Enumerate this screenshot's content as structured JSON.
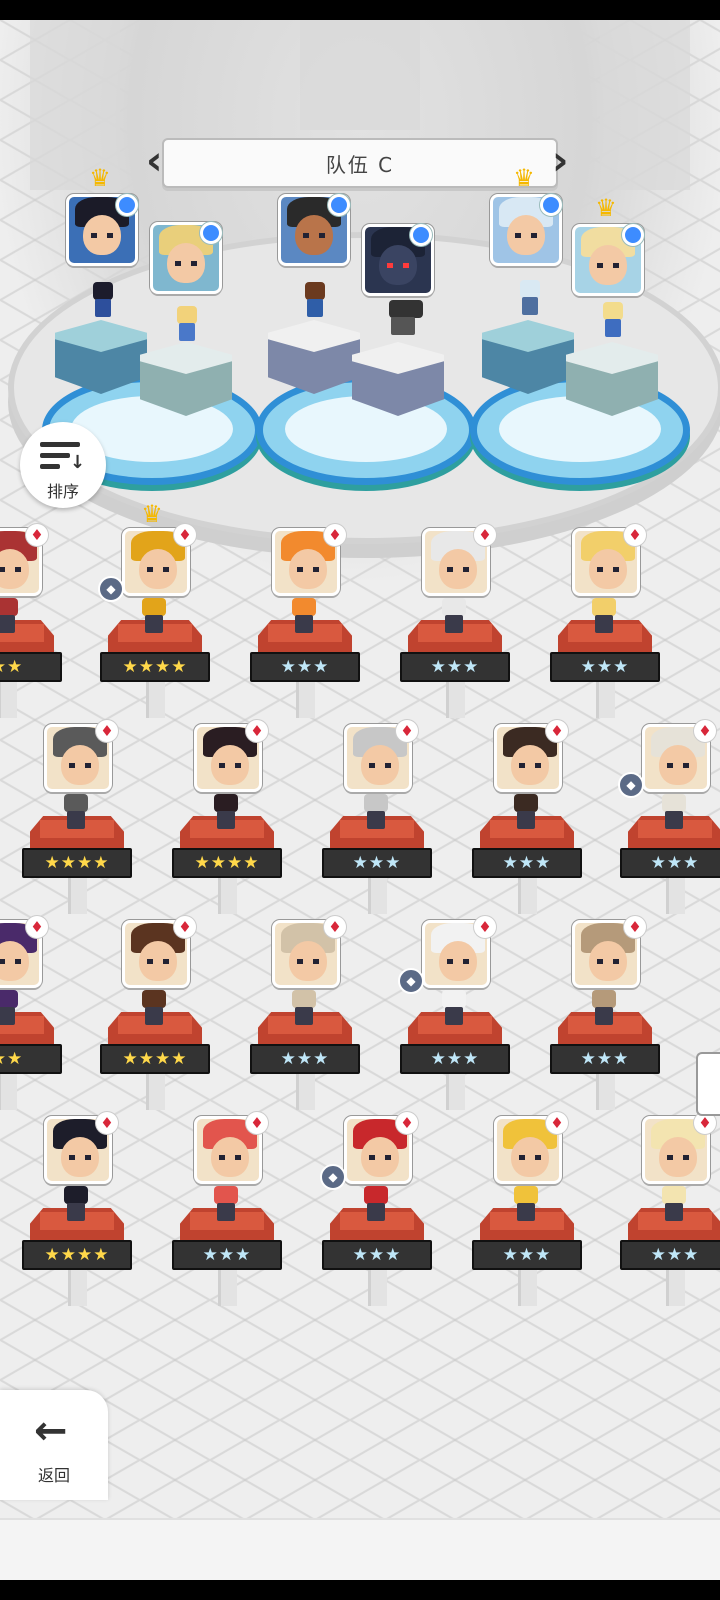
{
  "team": {
    "title": "队伍 C",
    "prev_icon": "chevron-left-icon",
    "next_icon": "chevron-right-icon"
  },
  "colors": {
    "accent": "#2f8fd6",
    "pedestal_red": "#c0432f",
    "star_gold": "#ffd84a",
    "star_silver": "#bfe6f7",
    "suit_red": "#d8273a"
  },
  "sort_button": {
    "label": "排序",
    "icon": "sort-descending-icon"
  },
  "back_button": {
    "label": "返回",
    "icon": "arrow-left-icon"
  },
  "roster_rows": [
    [
      {
        "stars": "★★",
        "gold": true,
        "suit": "♦",
        "hair": "#a33",
        "crown": false,
        "gem": false
      },
      {
        "stars": "★★★★",
        "gold": true,
        "suit": "♦",
        "hair": "#e2a41a",
        "crown": true,
        "gem": true
      },
      {
        "stars": "★★★",
        "gold": false,
        "suit": "♦",
        "hair": "#f28a2e",
        "crown": false,
        "gem": false
      },
      {
        "stars": "★★★",
        "gold": false,
        "suit": "♦",
        "hair": "#e8e8e8",
        "crown": false,
        "gem": false
      },
      {
        "stars": "★★★",
        "gold": false,
        "suit": "♦",
        "hair": "#f2cf6a",
        "crown": false,
        "gem": false
      }
    ],
    [
      {
        "stars": "★★★★",
        "gold": true,
        "suit": "♦",
        "hair": "#5a5a5a",
        "crown": false,
        "gem": false
      },
      {
        "stars": "★★★★",
        "gold": true,
        "suit": "♦",
        "hair": "#2a1d22",
        "crown": false,
        "gem": false
      },
      {
        "stars": "★★★",
        "gold": false,
        "suit": "♦",
        "hair": "#c7c7c7",
        "crown": false,
        "gem": false
      },
      {
        "stars": "★★★",
        "gold": false,
        "suit": "♦",
        "hair": "#3b2a22",
        "crown": false,
        "gem": false
      },
      {
        "stars": "★★★",
        "gold": false,
        "suit": "♦",
        "hair": "#e6e2d8",
        "crown": false,
        "gem": true
      }
    ],
    [
      {
        "stars": "★★",
        "gold": true,
        "suit": "♦",
        "hair": "#4a2a6a",
        "crown": false,
        "gem": false
      },
      {
        "stars": "★★★★",
        "gold": true,
        "suit": "♦",
        "hair": "#5b3420",
        "crown": false,
        "gem": false
      },
      {
        "stars": "★★★",
        "gold": false,
        "suit": "♦",
        "hair": "#d2c2a8",
        "crown": false,
        "gem": false
      },
      {
        "stars": "★★★",
        "gold": false,
        "suit": "♦",
        "hair": "#f2f2f2",
        "crown": false,
        "gem": true
      },
      {
        "stars": "★★★",
        "gold": false,
        "suit": "♦",
        "hair": "#b59a7a",
        "crown": false,
        "gem": false
      }
    ],
    [
      {
        "stars": "★★★★",
        "gold": true,
        "suit": "♦",
        "hair": "#1d1d2a",
        "crown": false,
        "gem": false
      },
      {
        "stars": "★★★",
        "gold": false,
        "suit": "♦",
        "hair": "#e2554d",
        "crown": false,
        "gem": false
      },
      {
        "stars": "★★★",
        "gold": false,
        "suit": "♦",
        "hair": "#c8282c",
        "crown": false,
        "gem": true
      },
      {
        "stars": "★★★",
        "gold": false,
        "suit": "♦",
        "hair": "#f0c23a",
        "crown": false,
        "gem": false
      },
      {
        "stars": "★★★",
        "gold": false,
        "suit": "♦",
        "hair": "#f3e4b0",
        "crown": false,
        "gem": false
      }
    ]
  ]
}
